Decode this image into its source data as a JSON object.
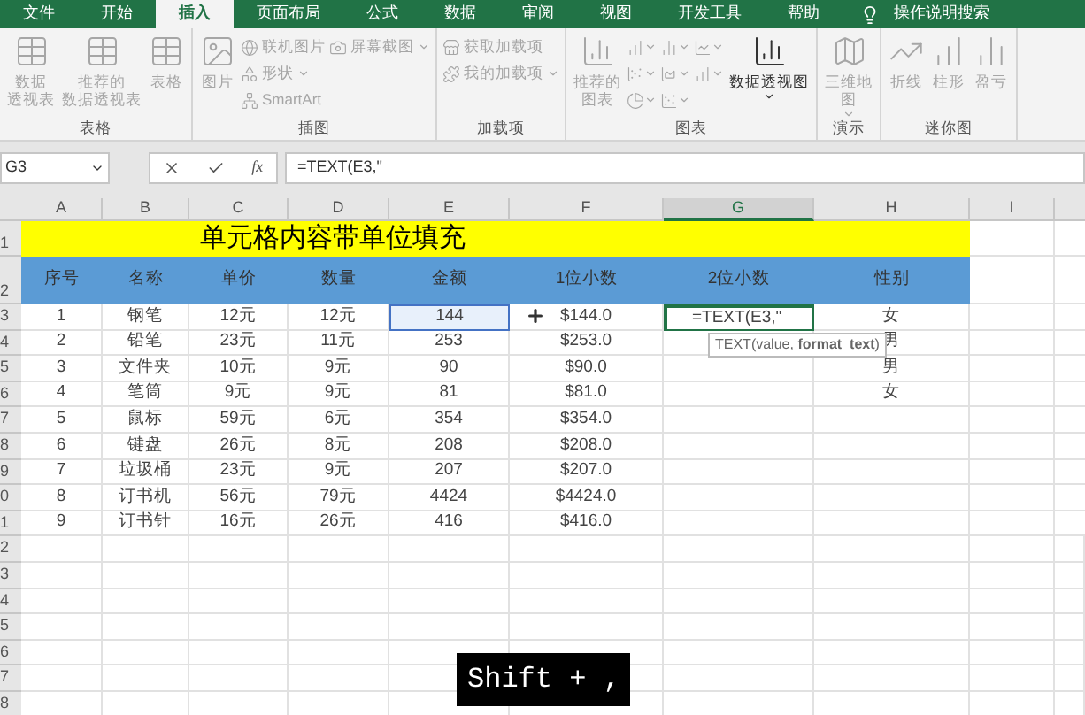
{
  "ribbon_tabs": [
    {
      "label": "文件",
      "selected": false
    },
    {
      "label": "开始",
      "selected": false
    },
    {
      "label": "插入",
      "selected": true
    },
    {
      "label": "页面布局",
      "selected": false
    },
    {
      "label": "公式",
      "selected": false
    },
    {
      "label": "数据",
      "selected": false
    },
    {
      "label": "审阅",
      "selected": false
    },
    {
      "label": "视图",
      "selected": false
    },
    {
      "label": "开发工具",
      "selected": false
    },
    {
      "label": "帮助",
      "selected": false
    }
  ],
  "tell_me": "操作说明搜索",
  "ribbon_groups": [
    {
      "label": "表格",
      "columns": [
        [
          {
            "kind": "large",
            "lines": [
              "数据",
              "透视表"
            ],
            "disabled": true
          }
        ],
        [
          {
            "kind": "large",
            "lines": [
              "推荐的",
              "数据透视表"
            ],
            "disabled": true
          }
        ],
        [
          {
            "kind": "large",
            "lines": [
              "表格"
            ],
            "disabled": true
          }
        ]
      ]
    },
    {
      "label": "插图",
      "columns": [
        [
          {
            "kind": "large",
            "lines": [
              "图片"
            ],
            "disabled": true
          }
        ],
        [
          {
            "kind": "small",
            "lines": [
              "联机图片"
            ],
            "disabled": true
          },
          {
            "kind": "small",
            "lines": [
              "形状"
            ],
            "disabled": true,
            "dropdown": true
          },
          {
            "kind": "small",
            "lines": [
              "SmartArt"
            ],
            "disabled": true
          }
        ],
        [
          {
            "kind": "small",
            "lines": [
              "屏幕截图"
            ],
            "disabled": true,
            "dropdown": true
          }
        ]
      ]
    },
    {
      "label": "加载项",
      "columns": [
        [
          {
            "kind": "small",
            "lines": [
              "获取加载项"
            ],
            "disabled": true
          },
          {
            "kind": "small",
            "lines": [
              "我的加载项"
            ],
            "disabled": true,
            "dropdown": true
          }
        ]
      ]
    },
    {
      "label": "图表",
      "columns": [
        [
          {
            "kind": "large",
            "lines": [
              "推荐的",
              "图表"
            ],
            "disabled": true
          }
        ],
        [
          {
            "kind": "icon",
            "disabled": true,
            "dropdown": true
          },
          {
            "kind": "icon",
            "disabled": true,
            "dropdown": true
          },
          {
            "kind": "icon",
            "disabled": true,
            "dropdown": true
          }
        ],
        [
          {
            "kind": "icon",
            "disabled": true,
            "dropdown": true
          },
          {
            "kind": "icon",
            "disabled": true,
            "dropdown": true
          },
          {
            "kind": "icon",
            "disabled": true,
            "dropdown": true
          }
        ],
        [
          {
            "kind": "icon",
            "disabled": true,
            "dropdown": true
          },
          {
            "kind": "icon",
            "disabled": true,
            "dropdown": true
          }
        ],
        [
          {
            "kind": "large",
            "lines": [
              "数据透视图"
            ],
            "disabled": false,
            "dropdown": true
          }
        ]
      ]
    },
    {
      "label": "演示",
      "columns": [
        [
          {
            "kind": "large",
            "lines": [
              "三维地",
              "图"
            ],
            "disabled": true,
            "dropdown": true
          }
        ]
      ]
    },
    {
      "label": "迷你图",
      "columns": [
        [
          {
            "kind": "large",
            "lines": [
              "折线"
            ],
            "disabled": true
          }
        ],
        [
          {
            "kind": "large",
            "lines": [
              "柱形"
            ],
            "disabled": true
          }
        ],
        [
          {
            "kind": "large",
            "lines": [
              "盈亏"
            ],
            "disabled": true
          }
        ]
      ]
    }
  ],
  "name_box": "G3",
  "fx": "fx",
  "formula": "=TEXT(E3,\"",
  "columns": [
    {
      "label": "A",
      "selected": false
    },
    {
      "label": "B",
      "selected": false
    },
    {
      "label": "C",
      "selected": false
    },
    {
      "label": "D",
      "selected": false
    },
    {
      "label": "E",
      "selected": false
    },
    {
      "label": "F",
      "selected": false
    },
    {
      "label": "G",
      "selected": true
    },
    {
      "label": "H",
      "selected": false
    },
    {
      "label": "I",
      "selected": false
    }
  ],
  "title_row": {
    "row": "1",
    "text": "单元格内容带单位填充"
  },
  "header_row": {
    "row": "2",
    "cells": [
      "序号",
      "名称",
      "单价",
      "数量",
      "金额",
      "1位小数",
      "2位小数",
      "性别"
    ]
  },
  "rows": [
    {
      "row": "3",
      "cells": [
        "1",
        "钢笔",
        "12元",
        "12元",
        "144",
        "$144.0",
        "=TEXT(E3,\"",
        "女"
      ],
      "amount_referenced": true,
      "editing": true
    },
    {
      "row": "4",
      "cells": [
        "2",
        "铅笔",
        "23元",
        "11元",
        "253",
        "$253.0",
        "",
        "男"
      ],
      "amount_referenced": false,
      "editing": false
    },
    {
      "row": "5",
      "cells": [
        "3",
        "文件夹",
        "10元",
        "9元",
        "90",
        "$90.0",
        "",
        "男"
      ],
      "amount_referenced": false,
      "editing": false
    },
    {
      "row": "6",
      "cells": [
        "4",
        "笔筒",
        "9元",
        "9元",
        "81",
        "$81.0",
        "",
        "女"
      ],
      "amount_referenced": false,
      "editing": false
    },
    {
      "row": "7",
      "cells": [
        "5",
        "鼠标",
        "59元",
        "6元",
        "354",
        "$354.0",
        "",
        ""
      ],
      "amount_referenced": false,
      "editing": false
    },
    {
      "row": "8",
      "cells": [
        "6",
        "键盘",
        "26元",
        "8元",
        "208",
        "$208.0",
        "",
        ""
      ],
      "amount_referenced": false,
      "editing": false
    },
    {
      "row": "9",
      "cells": [
        "7",
        "垃圾桶",
        "23元",
        "9元",
        "207",
        "$207.0",
        "",
        ""
      ],
      "amount_referenced": false,
      "editing": false
    },
    {
      "row": "0",
      "cells": [
        "8",
        "订书机",
        "56元",
        "79元",
        "4424",
        "$4424.0",
        "",
        ""
      ],
      "amount_referenced": false,
      "editing": false
    },
    {
      "row": "1",
      "cells": [
        "9",
        "订书针",
        "16元",
        "26元",
        "416",
        "$416.0",
        "",
        ""
      ],
      "amount_referenced": false,
      "editing": false
    }
  ],
  "empty_rows": [
    "2",
    "3",
    "4",
    "5",
    "6",
    "7",
    "8"
  ],
  "tooltip": "TEXT(value, **format_text**)",
  "key_overlay": "Shift + ,"
}
